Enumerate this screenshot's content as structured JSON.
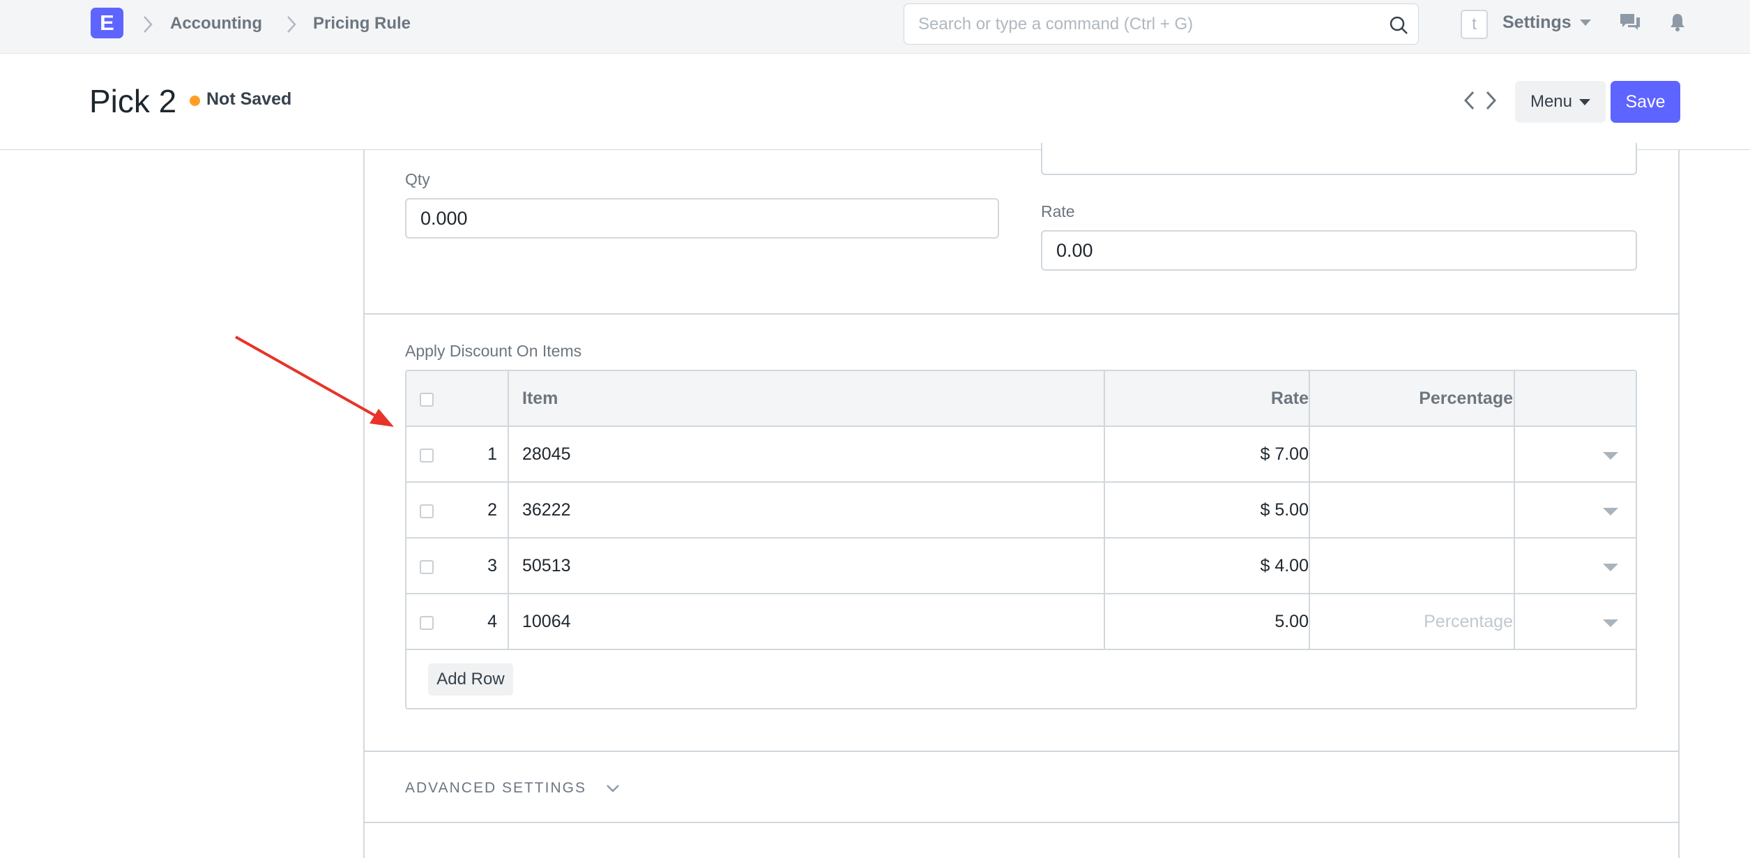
{
  "navbar": {
    "logo_letter": "E",
    "breadcrumbs": [
      "Accounting",
      "Pricing Rule"
    ],
    "search_placeholder": "Search or type a command (Ctrl + G)",
    "avatar_letter": "t",
    "settings_label": "Settings"
  },
  "page": {
    "title": "Pick 2",
    "status": "Not Saved",
    "menu_label": "Menu",
    "save_label": "Save"
  },
  "form": {
    "qty_label": "Qty",
    "qty_value": "0.000",
    "rate_label": "Rate",
    "rate_value": "0.00",
    "table_label": "Apply Discount On Items",
    "advanced_label": "ADVANCED SETTINGS"
  },
  "table": {
    "headers": {
      "item": "Item",
      "rate": "Rate",
      "percentage": "Percentage"
    },
    "rows": [
      {
        "idx": "1",
        "item": "28045",
        "rate": "$ 7.00",
        "percentage": ""
      },
      {
        "idx": "2",
        "item": "36222",
        "rate": "$ 5.00",
        "percentage": ""
      },
      {
        "idx": "3",
        "item": "50513",
        "rate": "$ 4.00",
        "percentage": ""
      },
      {
        "idx": "4",
        "item": "10064",
        "rate": "5.00",
        "percentage_placeholder": "Percentage"
      }
    ],
    "add_row_label": "Add Row"
  },
  "colors": {
    "primary": "#5e64ff",
    "status_dot": "#ff9d25",
    "annotation_arrow": "#e8332a"
  }
}
